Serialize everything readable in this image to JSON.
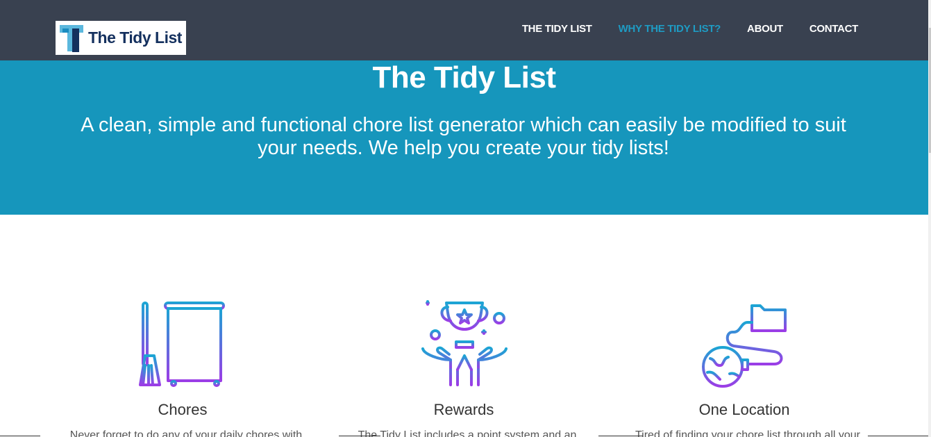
{
  "header": {
    "logo_text": "The Tidy List",
    "nav": [
      {
        "label": "THE TIDY LIST"
      },
      {
        "label": "WHY THE TIDY LIST?"
      },
      {
        "label": "ABOUT"
      },
      {
        "label": "CONTACT"
      }
    ],
    "active_nav": "WHY THE TIDY LIST?"
  },
  "hero": {
    "title": "The Tidy List",
    "subtitle": "A clean, simple and functional chore list generator which can easily be modified to suit your needs. We help you create your tidy lists!"
  },
  "features": [
    {
      "icon": "wardrobe-broom-icon",
      "title": "Chores",
      "text": "Never forget to do any of your daily chores with"
    },
    {
      "icon": "trophy-hands-icon",
      "title": "Rewards",
      "text": "The Tidy List includes a point system and an"
    },
    {
      "icon": "globe-folder-icon",
      "title": "One Location",
      "text": "Tired of finding your chore list through all your"
    }
  ],
  "colors": {
    "navbar": "#394150",
    "hero": "#1696bc",
    "accent": "#1e9bc3",
    "icon_gradient_top": "#1ca5d4",
    "icon_gradient_bottom": "#9b3de6"
  }
}
